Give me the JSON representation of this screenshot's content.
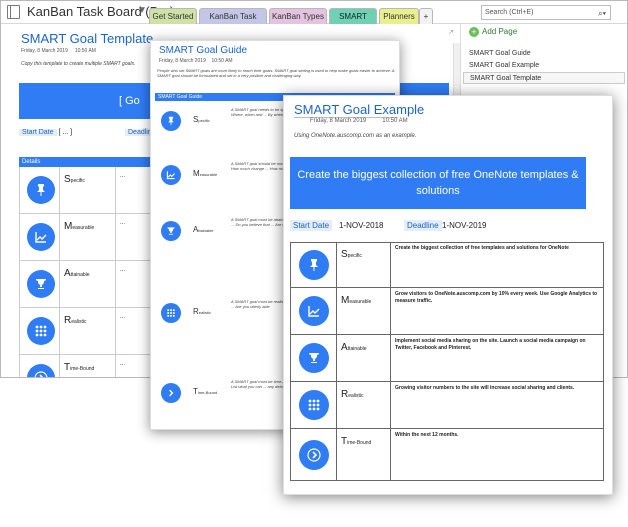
{
  "window": {
    "notebook_title": "KanBan Task Board (Pro)",
    "tabs": [
      "Get Started",
      "KanBan Task Board",
      "KanBan Types",
      "SMART Goals",
      "Planners",
      "+"
    ],
    "search_placeholder": "Search (Ctrl+E)"
  },
  "pages_panel": {
    "add_page": "Add Page",
    "pages": [
      "SMART Goal Guide",
      "SMART Goal Example",
      "SMART Goal Template"
    ]
  },
  "template_page": {
    "title": "SMART Goal Template",
    "date": "Friday, 8 March 2019",
    "time": "10:50 AM",
    "note": "Copy this template to create multiple SMART goals.",
    "banner": "[        Go",
    "start_label": "Start Date",
    "start_value": "[    ...    ]",
    "deadline_label": "Deadline",
    "details_header": "Details",
    "rows": [
      {
        "initial": "S",
        "rest": "pecific",
        "value": "..."
      },
      {
        "initial": "M",
        "rest": "easurable",
        "value": "..."
      },
      {
        "initial": "A",
        "rest": "ttainable",
        "value": "..."
      },
      {
        "initial": "R",
        "rest": "ealistic",
        "value": "..."
      },
      {
        "initial": "T",
        "rest": "ime-Bound",
        "value": "..."
      }
    ]
  },
  "guide_page": {
    "title": "SMART Goal Guide",
    "date": "Friday, 8 March 2019",
    "time": "10:50 AM",
    "intro": "People who set SMART goals are more likely to reach their goals. SMART goal setting is used to help make goals easier to achieve. A SMART goal should be formulated and set in a very positive and challenging way.",
    "header": "SMART Goal Guide",
    "rows": [
      {
        "initial": "S",
        "rest": "pecific",
        "text": "A SMART goal needs to be specific ... Exactly what do you want ... Are you doing this ... Where, when and ... By when do you want"
      },
      {
        "initial": "M",
        "rest": "easurable",
        "text": "A SMART goal should be measurable ... can determine the progress ... All what point ... How much change ... How many steps"
      },
      {
        "initial": "A",
        "rest": "ttainable",
        "text": "A SMART goal must be attainable ... be challenging and satisfying ... Do you already have ... Do you believe that ... Are the actions"
      },
      {
        "initial": "R",
        "rest": "ealistic",
        "text": "A SMART goal must be realistic ... Is this a meaningful ... Could it delay ... Are you able to ... Are you utterly able"
      },
      {
        "initial": "T",
        "rest": "ime-Bound",
        "text": "A SMART goal must be time-bound ... makes people switch to ... Set a realistic timeline ... List what you can ... any delays"
      }
    ]
  },
  "example_page": {
    "title": "SMART Goal Example",
    "date": "Friday, 8 March 2019",
    "time": "10:50 AM",
    "note": "Using OneNote.auscomp.com as an example.",
    "banner": "Create the biggest collection of free OneNote templates & solutions",
    "start_label": "Start Date",
    "start_value": "1-NOV-2018",
    "deadline_label": "Deadline",
    "deadline_value": "1-NOV-2019",
    "rows": [
      {
        "initial": "S",
        "rest": "pecific",
        "value": "Create the biggest collection of free templates and solutions for OneNote"
      },
      {
        "initial": "M",
        "rest": "easurable",
        "value": "Grow visitors to OneNote.auscomp.com by 10% every week. Use Google Analytics to measure traffic."
      },
      {
        "initial": "A",
        "rest": "ttainable",
        "value": "Implement social media sharing on the site. Launch a social media campaign on Twitter, Facebook and Pinterest."
      },
      {
        "initial": "R",
        "rest": "ealistic",
        "value": "Growing visitor numbers to the site will increase social sharing and clients."
      },
      {
        "initial": "T",
        "rest": "ime-Bound",
        "value": "Within the next 12 months."
      }
    ]
  },
  "colors": {
    "accent": "#2f7cf5",
    "title_blue": "#1b64c9",
    "tab_active": "#6fd0b2"
  }
}
